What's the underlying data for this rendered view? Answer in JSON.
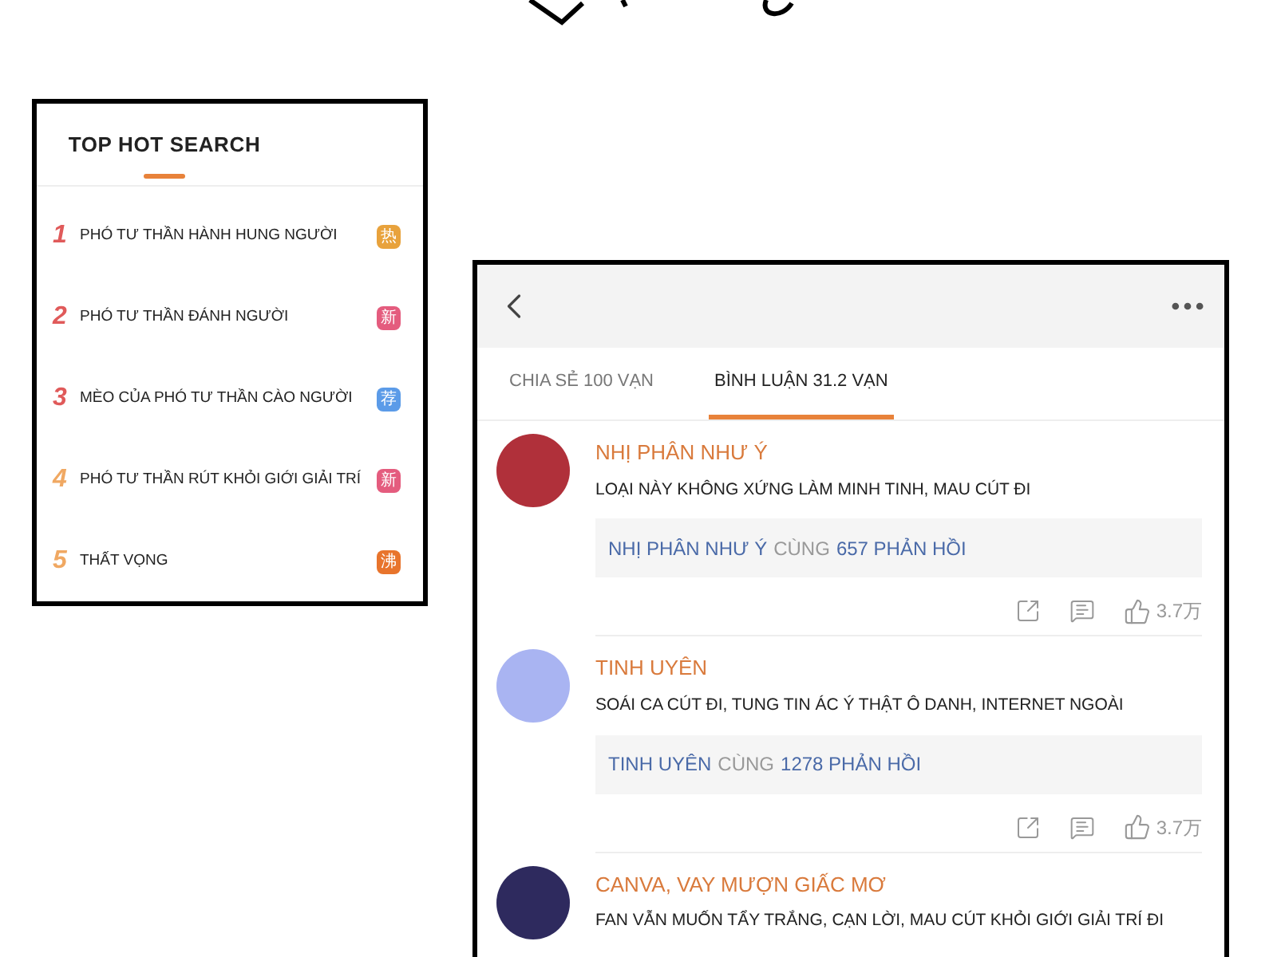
{
  "hot_search": {
    "title": "TOP HOT SEARCH",
    "items": [
      {
        "rank": "1",
        "text": "PHÓ TƯ THẦN HÀNH HUNG NGƯỜI",
        "badge": "热",
        "color": "#e8a23c"
      },
      {
        "rank": "2",
        "text": "PHÓ TƯ THẦN ĐÁNH NGƯỜI",
        "badge": "新",
        "color": "#e45c7e"
      },
      {
        "rank": "3",
        "text": "MÈO CỦA PHÓ TƯ THẦN CÀO NGƯỜI",
        "badge": "荐",
        "color": "#5b9be8"
      },
      {
        "rank": "4",
        "text": "PHÓ TƯ THẦN RÚT KHỎI GIỚI GIẢI TRÍ",
        "badge": "新",
        "color": "#e45c7e"
      },
      {
        "rank": "5",
        "text": "THẤT VỌNG",
        "badge": "沸",
        "color": "#e8742c"
      }
    ]
  },
  "post": {
    "tabs": [
      {
        "label": "CHIA SẺ 100 VẠN",
        "selected": false
      },
      {
        "label": "BÌNH LUẬN 31.2 VẠN",
        "selected": true
      }
    ],
    "comments": [
      {
        "user": "NHỊ PHÂN NHƯ Ý",
        "text": "LOẠI NÀY KHÔNG XỨNG LÀM MINH TINH, MAU CÚT ĐI",
        "reply": {
          "name": "NHỊ PHÂN NHƯ Ý",
          "joiner": "CÙNG",
          "count": "657 PHẢN HỒI"
        },
        "likes": "3.7万",
        "color": "#b0303a"
      },
      {
        "user": "TINH UYÊN",
        "text": "SOÁI CA CÚT ĐI, TUNG TIN ÁC Ý THẬT Ô DANH, INTERNET NGOÀI",
        "reply": {
          "name": "TINH UYÊN",
          "joiner": "CÙNG",
          "count": "1278 PHẢN HỒI"
        },
        "likes": "3.7万",
        "color": "#a9b4f2"
      },
      {
        "user": "CANVA, VAY MƯỢN GIẤC MƠ",
        "text": "FAN VẪN MUỐN TẨY TRẮNG, CẠN LỜI, MAU CÚT KHỎI GIỚI GIẢI TRÍ ĐI",
        "color": "#2e2a5e"
      }
    ]
  }
}
